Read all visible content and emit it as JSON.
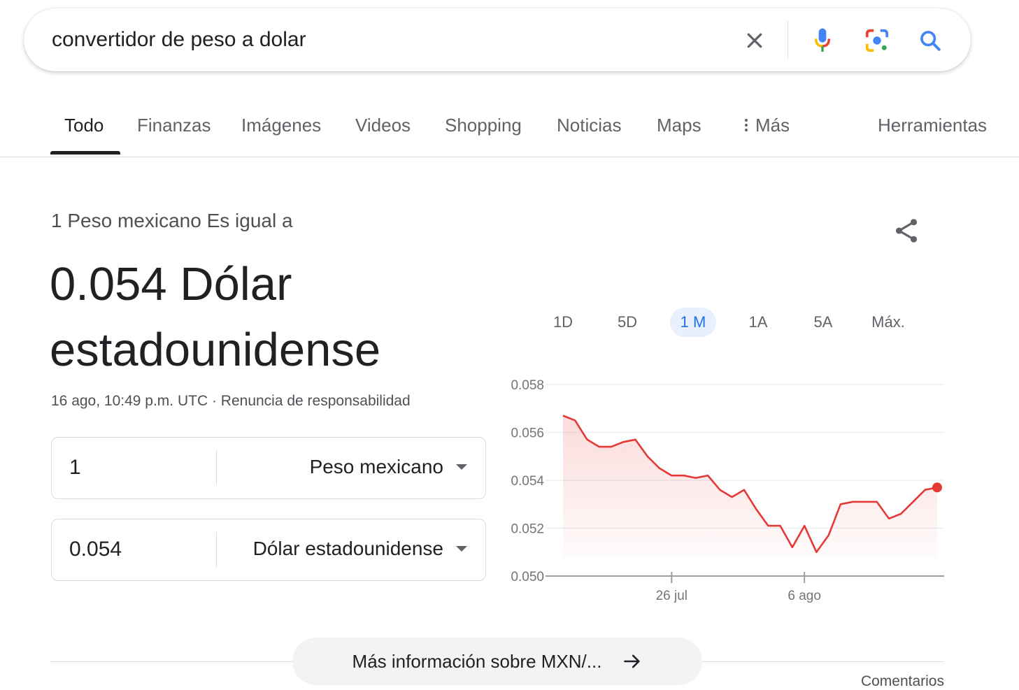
{
  "search": {
    "query": "convertidor de peso a dolar",
    "icons": [
      "close-icon",
      "microphone-icon",
      "lens-icon",
      "search-icon"
    ]
  },
  "tabs": [
    {
      "label": "Todo",
      "active": true
    },
    {
      "label": "Finanzas"
    },
    {
      "label": "Imágenes"
    },
    {
      "label": "Videos"
    },
    {
      "label": "Shopping"
    },
    {
      "label": "Noticias"
    },
    {
      "label": "Maps"
    },
    {
      "label": "Más",
      "icon": "more-vert-icon"
    },
    {
      "label": "Herramientas"
    }
  ],
  "result": {
    "equals_label": "1 Peso mexicano Es igual a",
    "big_value": "0.054 Dólar estadounidense",
    "timestamp": "16 ago, 10:49 p.m. UTC",
    "separator": " · ",
    "disclaimer": "Renuncia de responsabilidad",
    "share_icon": "share-icon"
  },
  "converter": {
    "from_value": "1",
    "from_currency": "Peso mexicano",
    "to_value": "0.054",
    "to_currency": "Dólar estadounidense"
  },
  "ranges": [
    "1D",
    "5D",
    "1 M",
    "1A",
    "5A",
    "Máx."
  ],
  "active_range": "1 M",
  "chart_data": {
    "type": "area",
    "x_ticks": [
      "26 jul",
      "6 ago"
    ],
    "y_ticks": [
      "0.058",
      "0.056",
      "0.054",
      "0.052",
      "0.050"
    ],
    "ylim": [
      0.05,
      0.058
    ],
    "grid": true,
    "line_color": "#e53935",
    "values": [
      0.0567,
      0.0565,
      0.0557,
      0.0554,
      0.0554,
      0.0556,
      0.0557,
      0.055,
      0.0545,
      0.0542,
      0.0542,
      0.0541,
      0.0542,
      0.0536,
      0.0533,
      0.0536,
      0.0528,
      0.0521,
      0.0521,
      0.0512,
      0.0521,
      0.051,
      0.0517,
      0.053,
      0.0531,
      0.0531,
      0.0531,
      0.0524,
      0.0526,
      0.0531,
      0.0536,
      0.0537
    ]
  },
  "footer": {
    "more_info": "Más información sobre MXN/...",
    "feedback": "Comentarios"
  },
  "colors": {
    "accent_blue": "#1a73e8",
    "chart_red": "#e53935",
    "text_primary": "#202124",
    "text_secondary": "#5f6368"
  }
}
